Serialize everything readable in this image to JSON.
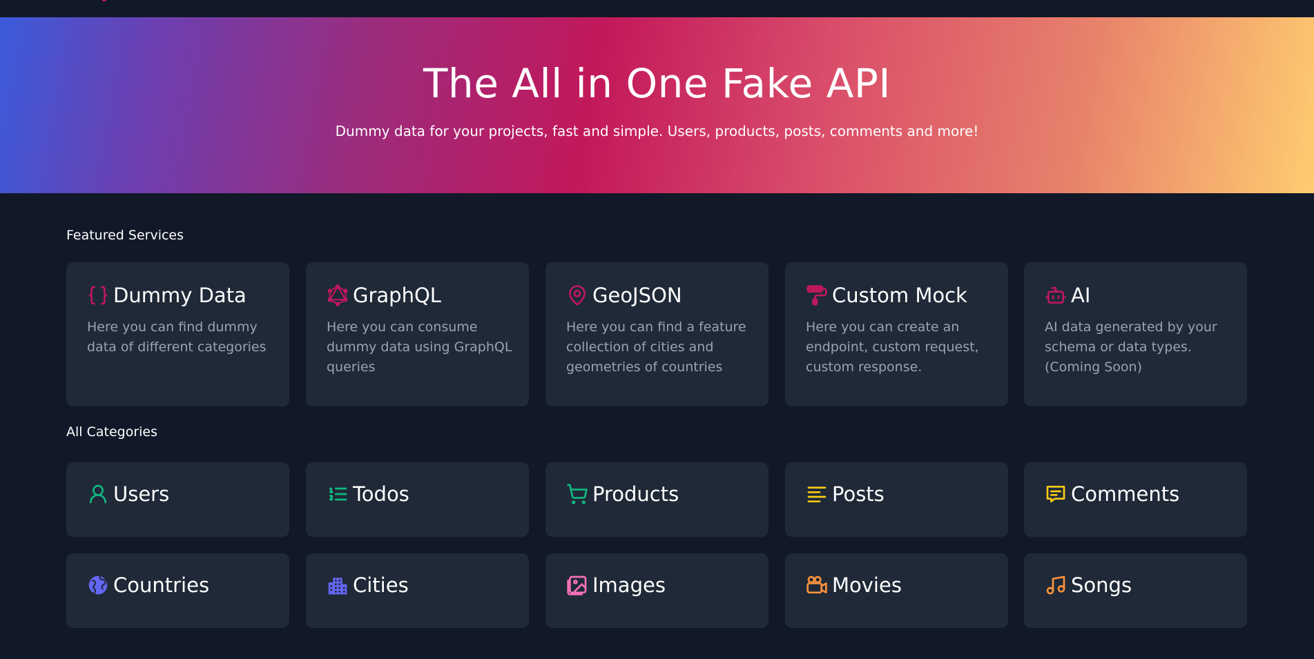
{
  "hero": {
    "title": "The All in One Fake API",
    "subtitle": "Dummy data for your projects, fast and simple. Users, products, posts, comments and more!"
  },
  "featured": {
    "label": "Featured Services",
    "items": [
      {
        "title": "Dummy Data",
        "desc": "Here you can find dummy data of different categories",
        "icon": "braces-icon"
      },
      {
        "title": "GraphQL",
        "desc": "Here you can consume dummy data using GraphQL queries",
        "icon": "graphql-icon"
      },
      {
        "title": "GeoJSON",
        "desc": "Here you can find a feature collection of cities and geometries of countries",
        "icon": "map-pin-icon"
      },
      {
        "title": "Custom Mock",
        "desc": "Here you can create an endpoint, custom request, custom response.",
        "icon": "paint-roller-icon"
      },
      {
        "title": "AI",
        "desc": "AI data generated by your schema or data types. (Coming Soon)",
        "icon": "robot-icon"
      }
    ]
  },
  "categories": {
    "label": "All Categories",
    "items": [
      {
        "title": "Users",
        "icon": "user-icon"
      },
      {
        "title": "Todos",
        "icon": "list-ordered-icon"
      },
      {
        "title": "Products",
        "icon": "shopping-cart-icon"
      },
      {
        "title": "Posts",
        "icon": "align-left-icon"
      },
      {
        "title": "Comments",
        "icon": "message-icon"
      },
      {
        "title": "Countries",
        "icon": "globe-icon"
      },
      {
        "title": "Cities",
        "icon": "building-icon"
      },
      {
        "title": "Images",
        "icon": "image-icon"
      },
      {
        "title": "Movies",
        "icon": "video-camera-icon"
      },
      {
        "title": "Songs",
        "icon": "music-note-icon"
      }
    ]
  },
  "colors": {
    "background": "#111827",
    "card": "#1f2937",
    "featured_icon": "#be185d",
    "green_icon": "#10b981",
    "yellow_icon": "#facc15",
    "indigo_icon": "#6366f1",
    "pink_icon": "#f472b6",
    "orange_icon": "#fb923c"
  }
}
